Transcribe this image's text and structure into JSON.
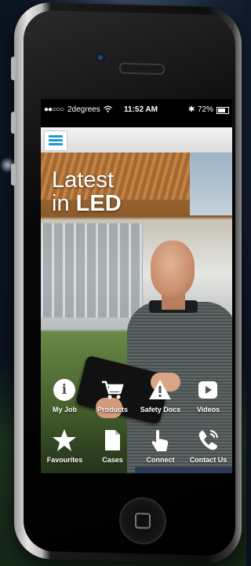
{
  "status_bar": {
    "carrier": "2degrees",
    "time": "11:52 AM",
    "battery": "72%"
  },
  "hero": {
    "headline_line1": "Latest",
    "headline_line2_prefix": "in",
    "headline_line2_bold": "LED"
  },
  "nav": {
    "items": [
      {
        "label": "My Job",
        "icon": "info-icon"
      },
      {
        "label": "Products",
        "icon": "cart-icon"
      },
      {
        "label": "Safety Docs",
        "icon": "warning-icon"
      },
      {
        "label": "Videos",
        "icon": "play-icon"
      },
      {
        "label": "Favourites",
        "icon": "star-icon"
      },
      {
        "label": "Cases",
        "icon": "document-icon"
      },
      {
        "label": "Connect",
        "icon": "touch-icon"
      },
      {
        "label": "Contact Us",
        "icon": "phone-icon"
      }
    ]
  },
  "colors": {
    "menu_accent": "#1a9ad6",
    "icon_white": "#ffffff"
  }
}
